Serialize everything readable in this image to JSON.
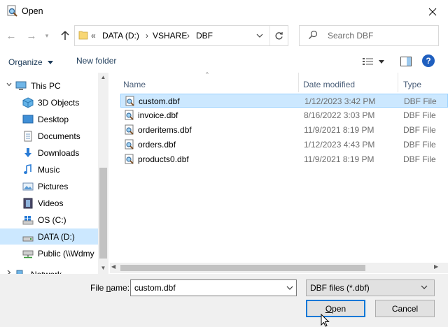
{
  "window": {
    "title": "Open",
    "icon": "file-magnifier-icon"
  },
  "address": {
    "crumbs": [
      "DATA (D:)",
      "VSHARE",
      "DBF"
    ],
    "chevron": "«",
    "separator": "›"
  },
  "search": {
    "placeholder": "Search DBF"
  },
  "toolbar": {
    "organize_label": "Organize",
    "new_folder_label": "New folder"
  },
  "nav": {
    "items": [
      {
        "label": "This PC",
        "icon": "computer-icon"
      },
      {
        "label": "3D Objects",
        "icon": "cube-icon"
      },
      {
        "label": "Desktop",
        "icon": "desktop-icon"
      },
      {
        "label": "Documents",
        "icon": "documents-icon"
      },
      {
        "label": "Downloads",
        "icon": "download-arrow-icon"
      },
      {
        "label": "Music",
        "icon": "music-note-icon"
      },
      {
        "label": "Pictures",
        "icon": "pictures-icon"
      },
      {
        "label": "Videos",
        "icon": "film-icon"
      },
      {
        "label": "OS (C:)",
        "icon": "windows-drive-icon"
      },
      {
        "label": "DATA (D:)",
        "icon": "drive-icon"
      },
      {
        "label": "Public (\\\\Wdmy",
        "icon": "network-drive-icon"
      },
      {
        "label": "Network",
        "icon": "network-icon"
      }
    ],
    "selected": "DATA (D:)"
  },
  "columns": {
    "name": "Name",
    "date": "Date modified",
    "type": "Type"
  },
  "files": [
    {
      "name": "custom.dbf",
      "date": "1/12/2023 3:42 PM",
      "type": "DBF File"
    },
    {
      "name": "invoice.dbf",
      "date": "8/16/2022 3:03 PM",
      "type": "DBF File"
    },
    {
      "name": "orderitems.dbf",
      "date": "11/9/2021 8:19 PM",
      "type": "DBF File"
    },
    {
      "name": "orders.dbf",
      "date": "1/12/2023 4:43 PM",
      "type": "DBF File"
    },
    {
      "name": "products0.dbf",
      "date": "11/9/2021 8:19 PM",
      "type": "DBF File"
    }
  ],
  "selected_file": "custom.dbf",
  "bottom": {
    "filename_label_prefix": "File ",
    "filename_label_mnemonic": "n",
    "filename_label_suffix": "ame:",
    "filename_value": "custom.dbf",
    "filetype_value": "DBF files (*.dbf)",
    "open_mnemonic": "O",
    "open_rest": "pen",
    "cancel_label": "Cancel"
  },
  "colors": {
    "selection": "#cce8ff",
    "selection_border": "#99d1ff",
    "accent": "#0078d7",
    "panel": "#f0f0f0"
  }
}
